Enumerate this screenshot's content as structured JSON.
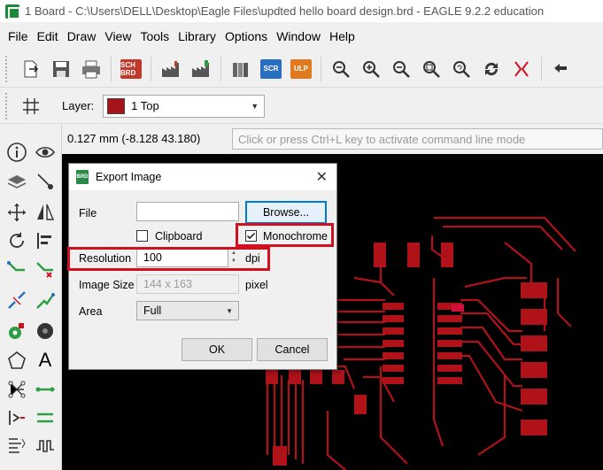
{
  "window": {
    "title": "1 Board - C:\\Users\\DELL\\Desktop\\Eagle Files\\updted hello board design.brd - EAGLE 9.2.2 education"
  },
  "menu": [
    "File",
    "Edit",
    "Draw",
    "View",
    "Tools",
    "Library",
    "Options",
    "Window",
    "Help"
  ],
  "toolbar": {
    "sch_brd_label": "SCH BRD",
    "scr_label": "SCR",
    "ulp_label": "ULP"
  },
  "layerbar": {
    "label": "Layer:",
    "selected": "1 Top",
    "swatch_color": "#a4141a"
  },
  "status": {
    "coordinates": "0.127 mm (-8.128 43.180)",
    "command_placeholder": "Click or press Ctrl+L key to activate command line mode"
  },
  "left_tools": {
    "text_tool": "A"
  },
  "dialog": {
    "title": "Export Image",
    "icon_label": "BRD",
    "close": "✕",
    "file_label": "File",
    "file_value": "",
    "browse_label": "Browse...",
    "clipboard_label": "Clipboard",
    "clipboard_checked": false,
    "monochrome_label": "Monochrome",
    "monochrome_checked": true,
    "resolution_label": "Resolution",
    "resolution_value": "100",
    "resolution_unit": "dpi",
    "image_size_label": "Image Size",
    "image_size_value": "144 x 163",
    "image_size_unit": "pixel",
    "area_label": "Area",
    "area_value": "Full",
    "ok_label": "OK",
    "cancel_label": "Cancel"
  },
  "colors": {
    "highlight": "#d01020",
    "trace": "#b0121a",
    "canvas": "#000000"
  }
}
